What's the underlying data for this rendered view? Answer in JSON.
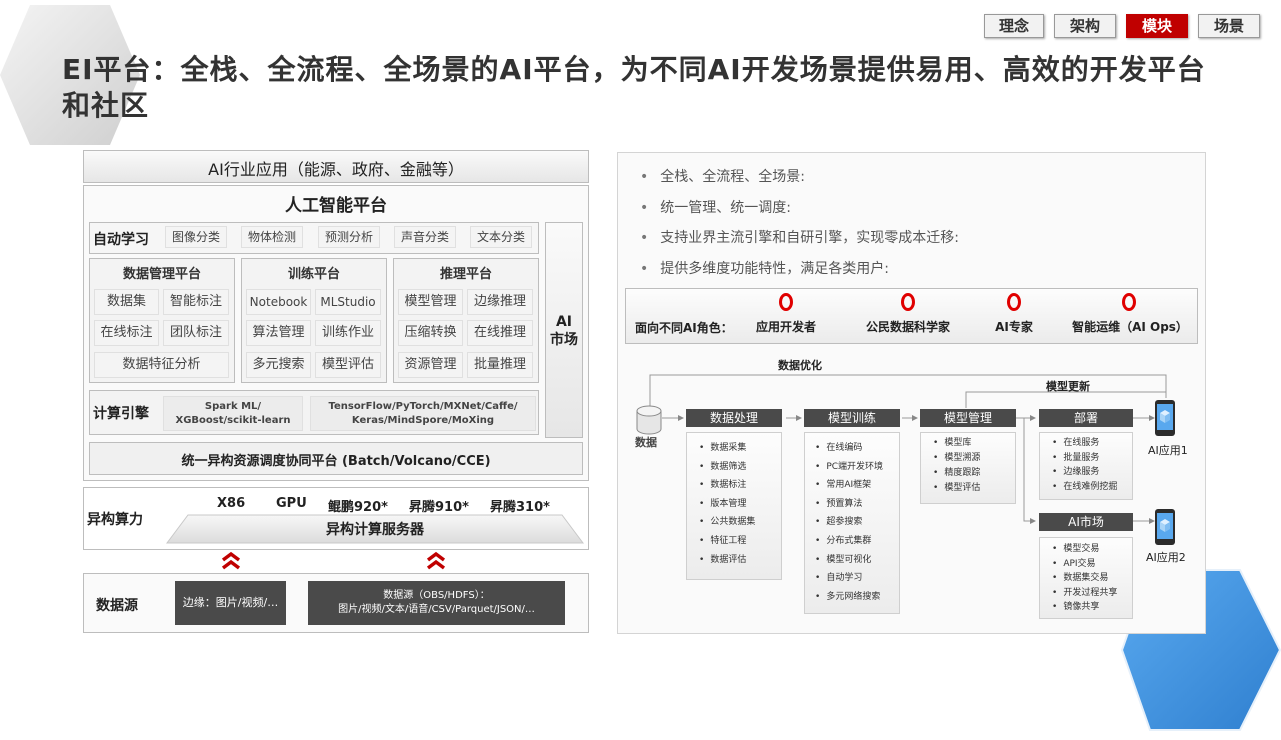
{
  "nav": {
    "tabs": [
      "理念",
      "架构",
      "模块",
      "场景"
    ],
    "active_index": 2
  },
  "title": "EI平台：全栈、全流程、全场景的AI平台，为不同AI开发场景提供易用、高效的开发平台和社区",
  "left": {
    "industry": "AI行业应用（能源、政府、金融等）",
    "platform_title": "人工智能平台",
    "automl": {
      "label": "自动学习",
      "items": [
        "图像分类",
        "物体检测",
        "预测分析",
        "声音分类",
        "文本分类"
      ]
    },
    "data_mgmt": {
      "title": "数据管理平台",
      "items": [
        "数据集",
        "智能标注",
        "在线标注",
        "团队标注",
        "数据特征分析"
      ]
    },
    "training": {
      "title": "训练平台",
      "items": [
        "Notebook",
        "MLStudio",
        "算法管理",
        "训练作业",
        "多元搜索",
        "模型评估"
      ]
    },
    "inference": {
      "title": "推理平台",
      "items": [
        "模型管理",
        "边缘推理",
        "压缩转换",
        "在线推理",
        "资源管理",
        "批量推理"
      ]
    },
    "ai_market": "AI\n市场",
    "compute_engine": {
      "label": "计算引擎",
      "engine1": "Spark ML/\nXGBoost/scikit-learn",
      "engine2": "TensorFlow/PyTorch/MXNet/Caffe/\nKeras/MindSpore/MoXing"
    },
    "scheduler": "统一异构资源调度协同平台 (Batch/Volcano/CCE)",
    "hetero": {
      "label": "异构算力",
      "chips": [
        "X86",
        "GPU",
        "鲲鹏920*",
        "昇腾910*",
        "昇腾310*"
      ],
      "server": "异构计算服务器"
    },
    "datasource": {
      "label": "数据源",
      "edge": "边缘：图片/视频/…",
      "main": "数据源（OBS/HDFS）：\n图片/视频/文本/语音/CSV/Parquet/JSON/…"
    }
  },
  "right": {
    "bullets": [
      "全栈、全流程、全场景:",
      "统一管理、统一调度:",
      "支持业界主流引擎和自研引擎，实现零成本迁移:",
      "提供多维度功能特性，满足各类用户:"
    ],
    "roles_label": "面向不同AI角色：",
    "roles": [
      "应用开发者",
      "公民数据科学家",
      "AI专家",
      "智能运维（AI Ops）"
    ],
    "flow": {
      "data_label": "数据",
      "data_opt": "数据优化",
      "model_update": "模型更新",
      "stages": [
        {
          "name": "数据处理",
          "items": [
            "数据采集",
            "数据筛选",
            "数据标注",
            "版本管理",
            "公共数据集",
            "特征工程",
            "数据评估"
          ]
        },
        {
          "name": "模型训练",
          "items": [
            "在线编码",
            "PC端开发环境",
            "常用AI框架",
            "预置算法",
            "超参搜索",
            "分布式集群",
            "模型可视化",
            "自动学习",
            "多元网络搜索"
          ]
        },
        {
          "name": "模型管理",
          "items": [
            "模型库",
            "模型溯源",
            "精度跟踪",
            "模型评估"
          ]
        },
        {
          "name": "部署",
          "items": [
            "在线服务",
            "批量服务",
            "边缘服务",
            "在线难例挖掘"
          ]
        },
        {
          "name": "AI市场",
          "items": [
            "模型交易",
            "API交易",
            "数据集交易",
            "开发过程共享",
            "镜像共享"
          ]
        }
      ],
      "app1": "AI应用1",
      "app2": "AI应用2"
    }
  },
  "colors": {
    "accent": "#c00000",
    "ring": "#e00000",
    "dark": "#4a4a4a",
    "hex_blue": "#3d8fd6"
  }
}
